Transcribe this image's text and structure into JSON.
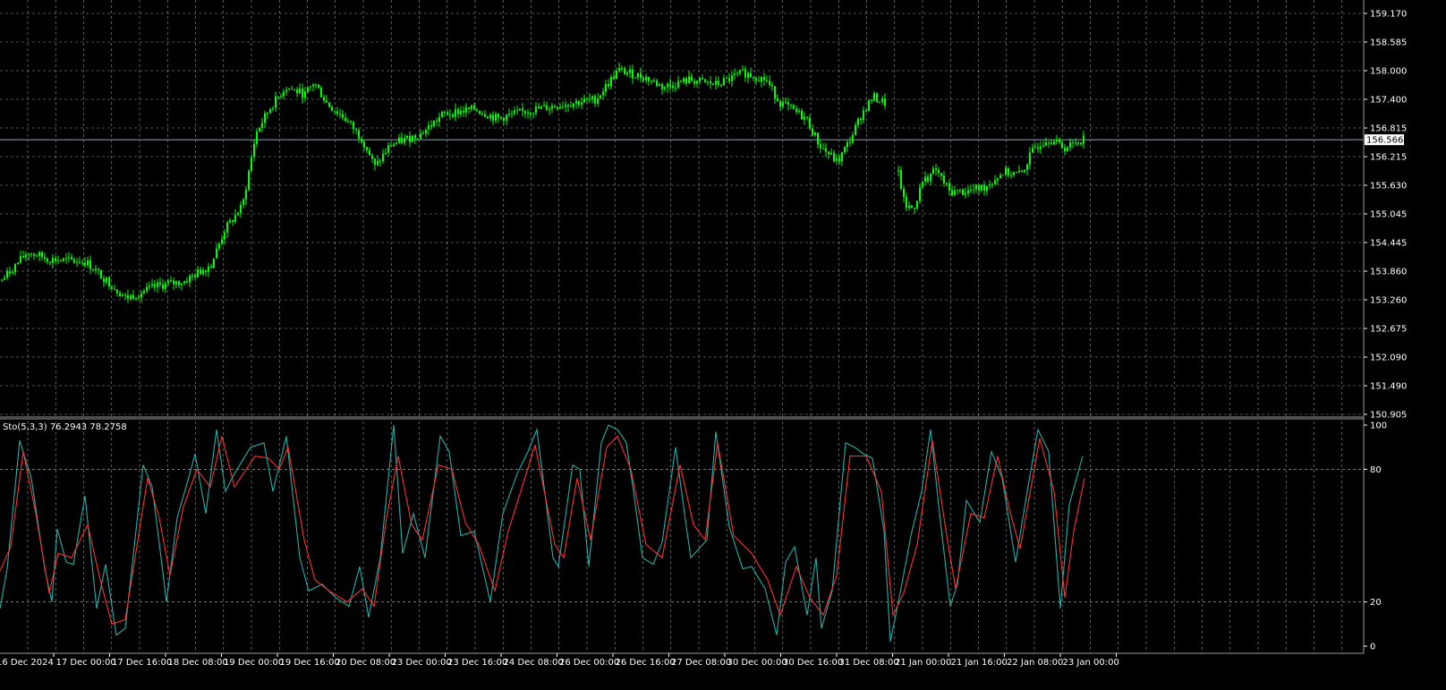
{
  "colors": {
    "background": "#000000",
    "grid": "#c8c8c8",
    "candle": "#00ff00",
    "stoch_main": "#20b2aa",
    "stoch_signal": "#ff3030",
    "current_price_line": "#8fa2b0",
    "axis_text": "#ffffff"
  },
  "indicator": {
    "title": "Sto(5,3,3) 76.2943 78.2758"
  },
  "chart_data": [
    {
      "type": "candlestick",
      "title": "",
      "ylim": [
        150.905,
        159.17
      ],
      "current_price": 156.566,
      "current_price_label": "156.566",
      "y_ticks": [
        "159.170",
        "158.585",
        "158.000",
        "157.400",
        "156.815",
        "156.215",
        "155.630",
        "155.045",
        "154.445",
        "153.860",
        "153.260",
        "152.675",
        "152.090",
        "151.490",
        "150.905"
      ],
      "x_labels": [
        "16 Dec 2024",
        "17 Dec 00:00",
        "17 Dec 16:00",
        "18 Dec 08:00",
        "19 Dec 00:00",
        "19 Dec 16:00",
        "20 Dec 08:00",
        "23 Dec 00:00",
        "23 Dec 16:00",
        "24 Dec 08:00",
        "26 Dec 00:00",
        "26 Dec 16:00",
        "27 Dec 08:00",
        "30 Dec 00:00",
        "30 Dec 16:00",
        "31 Dec 08:00",
        "21 Jan 00:00",
        "21 Jan 16:00",
        "22 Jan 08:00",
        "23 Jan 00:00"
      ],
      "grid": true,
      "price_path": [
        [
          0,
          153.65
        ],
        [
          30,
          154.25
        ],
        [
          55,
          154.1
        ],
        [
          95,
          154.05
        ],
        [
          140,
          153.3
        ],
        [
          175,
          153.55
        ],
        [
          205,
          153.65
        ],
        [
          235,
          154.0
        ],
        [
          250,
          154.7
        ],
        [
          270,
          155.2
        ],
        [
          285,
          156.7
        ],
        [
          300,
          157.2
        ],
        [
          318,
          157.65
        ],
        [
          340,
          157.5
        ],
        [
          350,
          157.75
        ],
        [
          365,
          157.3
        ],
        [
          385,
          157.0
        ],
        [
          405,
          156.55
        ],
        [
          418,
          156.0
        ],
        [
          435,
          156.45
        ],
        [
          470,
          156.7
        ],
        [
          495,
          157.1
        ],
        [
          530,
          157.2
        ],
        [
          555,
          157.0
        ],
        [
          585,
          157.15
        ],
        [
          630,
          157.3
        ],
        [
          665,
          157.4
        ],
        [
          690,
          158.0
        ],
        [
          720,
          157.85
        ],
        [
          740,
          157.65
        ],
        [
          770,
          157.8
        ],
        [
          800,
          157.7
        ],
        [
          830,
          157.95
        ],
        [
          855,
          157.8
        ],
        [
          870,
          157.35
        ],
        [
          900,
          157.0
        ],
        [
          915,
          156.45
        ],
        [
          935,
          156.1
        ],
        [
          950,
          156.6
        ],
        [
          962,
          157.1
        ],
        [
          975,
          157.45
        ],
        [
          990,
          157.3
        ],
        [
          1002,
          156.0
        ],
        [
          1010,
          155.2
        ],
        [
          1020,
          155.15
        ],
        [
          1030,
          155.7
        ],
        [
          1045,
          155.95
        ],
        [
          1060,
          155.5
        ],
        [
          1080,
          155.5
        ],
        [
          1100,
          155.6
        ],
        [
          1120,
          155.9
        ],
        [
          1140,
          155.85
        ],
        [
          1155,
          156.4
        ],
        [
          1170,
          156.6
        ],
        [
          1190,
          156.4
        ],
        [
          1210,
          156.6
        ]
      ]
    },
    {
      "type": "line",
      "title": "Sto(5,3,3)",
      "ylim": [
        0,
        100
      ],
      "y_ticks": [
        "100",
        "80",
        "20",
        "0"
      ],
      "levels": [
        80,
        20
      ],
      "series": [
        {
          "name": "",
          "color_key": "stoch_main",
          "values": [
            [
              0,
              17
            ],
            [
              8,
              35
            ],
            [
              22,
              93
            ],
            [
              35,
              76
            ],
            [
              50,
              35
            ],
            [
              58,
              20
            ],
            [
              64,
              53
            ],
            [
              74,
              38
            ],
            [
              82,
              37
            ],
            [
              95,
              68
            ],
            [
              108,
              17
            ],
            [
              118,
              37
            ],
            [
              130,
              5
            ],
            [
              140,
              8
            ],
            [
              160,
              82
            ],
            [
              170,
              72
            ],
            [
              180,
              40
            ],
            [
              186,
              20
            ],
            [
              198,
              58
            ],
            [
              210,
              75
            ],
            [
              218,
              87
            ],
            [
              230,
              60
            ],
            [
              242,
              98
            ],
            [
              252,
              70
            ],
            [
              262,
              78
            ],
            [
              280,
              90
            ],
            [
              295,
              92
            ],
            [
              305,
              70
            ],
            [
              320,
              95
            ],
            [
              335,
              40
            ],
            [
              345,
              25
            ],
            [
              360,
              28
            ],
            [
              375,
              22
            ],
            [
              390,
              18
            ],
            [
              402,
              36
            ],
            [
              412,
              13
            ],
            [
              425,
              40
            ],
            [
              440,
              100
            ],
            [
              450,
              42
            ],
            [
              462,
              60
            ],
            [
              475,
              40
            ],
            [
              492,
              95
            ],
            [
              502,
              88
            ],
            [
              515,
              50
            ],
            [
              530,
              52
            ],
            [
              548,
              20
            ],
            [
              562,
              60
            ],
            [
              578,
              78
            ],
            [
              590,
              88
            ],
            [
              600,
              98
            ],
            [
              618,
              40
            ],
            [
              624,
              36
            ],
            [
              640,
              82
            ],
            [
              648,
              80
            ],
            [
              658,
              36
            ],
            [
              672,
              92
            ],
            [
              680,
              100
            ],
            [
              690,
              98
            ],
            [
              700,
              92
            ],
            [
              708,
              70
            ],
            [
              718,
              40
            ],
            [
              730,
              37
            ],
            [
              740,
              47
            ],
            [
              755,
              90
            ],
            [
              765,
              60
            ],
            [
              772,
              40
            ],
            [
              790,
              48
            ],
            [
              800,
              97
            ],
            [
              815,
              54
            ],
            [
              830,
              35
            ],
            [
              840,
              36
            ],
            [
              855,
              26
            ],
            [
              868,
              5
            ],
            [
              878,
              38
            ],
            [
              888,
              45
            ],
            [
              902,
              14
            ],
            [
              912,
              40
            ],
            [
              918,
              8
            ],
            [
              930,
              25
            ],
            [
              945,
              92
            ],
            [
              955,
              90
            ],
            [
              965,
              87
            ],
            [
              975,
              85
            ],
            [
              988,
              52
            ],
            [
              995,
              2
            ],
            [
              1005,
              22
            ],
            [
              1018,
              50
            ],
            [
              1030,
              70
            ],
            [
              1040,
              98
            ],
            [
              1050,
              60
            ],
            [
              1062,
              18
            ],
            [
              1070,
              28
            ],
            [
              1080,
              66
            ],
            [
              1095,
              56
            ],
            [
              1108,
              88
            ],
            [
              1120,
              76
            ],
            [
              1135,
              38
            ],
            [
              1148,
              70
            ],
            [
              1160,
              98
            ],
            [
              1172,
              88
            ],
            [
              1185,
              17
            ],
            [
              1195,
              64
            ],
            [
              1210,
              86
            ]
          ]
        },
        {
          "name": "",
          "color_key": "stoch_signal",
          "values": [
            [
              0,
              34
            ],
            [
              12,
              45
            ],
            [
              26,
              88
            ],
            [
              40,
              60
            ],
            [
              55,
              24
            ],
            [
              65,
              42
            ],
            [
              80,
              40
            ],
            [
              98,
              55
            ],
            [
              112,
              30
            ],
            [
              125,
              10
            ],
            [
              140,
              12
            ],
            [
              165,
              76
            ],
            [
              178,
              58
            ],
            [
              190,
              32
            ],
            [
              205,
              63
            ],
            [
              220,
              80
            ],
            [
              235,
              72
            ],
            [
              248,
              95
            ],
            [
              262,
              72
            ],
            [
              285,
              86
            ],
            [
              300,
              85
            ],
            [
              312,
              80
            ],
            [
              322,
              90
            ],
            [
              340,
              48
            ],
            [
              352,
              30
            ],
            [
              368,
              25
            ],
            [
              388,
              20
            ],
            [
              405,
              26
            ],
            [
              418,
              18
            ],
            [
              432,
              58
            ],
            [
              445,
              86
            ],
            [
              460,
              55
            ],
            [
              472,
              48
            ],
            [
              490,
              82
            ],
            [
              505,
              80
            ],
            [
              520,
              56
            ],
            [
              535,
              46
            ],
            [
              553,
              25
            ],
            [
              568,
              52
            ],
            [
              582,
              70
            ],
            [
              598,
              91
            ],
            [
              620,
              46
            ],
            [
              630,
              40
            ],
            [
              645,
              76
            ],
            [
              660,
              48
            ],
            [
              678,
              90
            ],
            [
              690,
              95
            ],
            [
              705,
              80
            ],
            [
              722,
              46
            ],
            [
              740,
              40
            ],
            [
              760,
              82
            ],
            [
              775,
              55
            ],
            [
              788,
              48
            ],
            [
              802,
              92
            ],
            [
              820,
              50
            ],
            [
              840,
              42
            ],
            [
              858,
              30
            ],
            [
              872,
              14
            ],
            [
              890,
              36
            ],
            [
              905,
              22
            ],
            [
              920,
              14
            ],
            [
              935,
              32
            ],
            [
              950,
              86
            ],
            [
              968,
              86
            ],
            [
              985,
              70
            ],
            [
              998,
              14
            ],
            [
              1010,
              24
            ],
            [
              1025,
              46
            ],
            [
              1042,
              93
            ],
            [
              1058,
              50
            ],
            [
              1068,
              26
            ],
            [
              1085,
              60
            ],
            [
              1100,
              58
            ],
            [
              1115,
              86
            ],
            [
              1128,
              62
            ],
            [
              1140,
              44
            ],
            [
              1162,
              94
            ],
            [
              1178,
              70
            ],
            [
              1190,
              22
            ],
            [
              1200,
              52
            ],
            [
              1212,
              76
            ]
          ]
        }
      ]
    }
  ]
}
